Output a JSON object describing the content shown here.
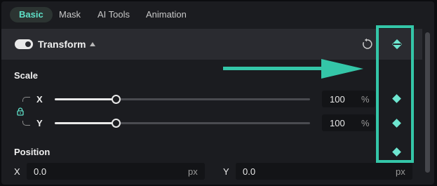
{
  "tabs": [
    {
      "label": "Basic",
      "active": true
    },
    {
      "label": "Mask",
      "active": false
    },
    {
      "label": "AI Tools",
      "active": false
    },
    {
      "label": "Animation",
      "active": false
    }
  ],
  "transform": {
    "title": "Transform",
    "enabled": true,
    "expanded": true
  },
  "scale": {
    "label": "Scale",
    "locked": true,
    "x": {
      "axis": "X",
      "value": "100",
      "unit": "%",
      "slider_fraction": 0.24
    },
    "y": {
      "axis": "Y",
      "value": "100",
      "unit": "%",
      "slider_fraction": 0.24
    }
  },
  "position": {
    "label": "Position",
    "x": {
      "axis": "X",
      "value": "0.0",
      "unit": "px"
    },
    "y": {
      "axis": "Y",
      "value": "0.0",
      "unit": "px"
    }
  },
  "colors": {
    "accent": "#5fe0c8",
    "keyframe": "#6ee6d0",
    "annotation": "#34c6a8"
  },
  "icons": [
    "toggle-switch",
    "caret-up-icon",
    "reset-icon",
    "keyframe-diamond-icon",
    "lock-icon"
  ]
}
